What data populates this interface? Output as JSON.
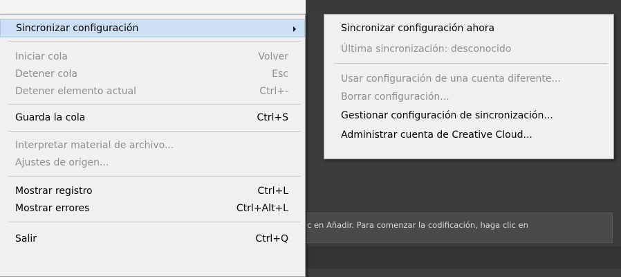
{
  "main_menu": {
    "sync": {
      "label": "Sincronizar configuración"
    },
    "start_queue": {
      "label": "Iniciar cola",
      "shortcut": "Volver"
    },
    "stop_queue": {
      "label": "Detener cola",
      "shortcut": "Esc"
    },
    "stop_current": {
      "label": "Detener elemento actual",
      "shortcut": "Ctrl+-"
    },
    "save_queue": {
      "label": "Guarda la cola",
      "shortcut": "Ctrl+S"
    },
    "interpret": {
      "label": "Interpretar material de archivo..."
    },
    "source_settings": {
      "label": "Ajustes de origen..."
    },
    "show_log": {
      "label": "Mostrar registro",
      "shortcut": "Ctrl+L"
    },
    "show_errors": {
      "label": "Mostrar errores",
      "shortcut": "Ctrl+Alt+L"
    },
    "exit": {
      "label": "Salir",
      "shortcut": "Ctrl+Q"
    }
  },
  "sync_submenu": {
    "sync_now": "Sincronizar configuración ahora",
    "last_sync": "Última sincronización: desconocido",
    "use_other_account": "Usar configuración de una cuenta diferente...",
    "clear_settings": "Borrar configuración...",
    "manage_sync": "Gestionar configuración de sincronización...",
    "manage_cc": "Administrar cuenta de Creative Cloud..."
  },
  "background": {
    "hint_text": "c en Añadir. Para comenzar la codificación, haga clic en"
  },
  "colors": {
    "menu_bg": "#f0f0f0",
    "highlight": "#ccdff5",
    "disabled_text": "#8f8f8f",
    "app_bg": "#3c3c3c"
  }
}
